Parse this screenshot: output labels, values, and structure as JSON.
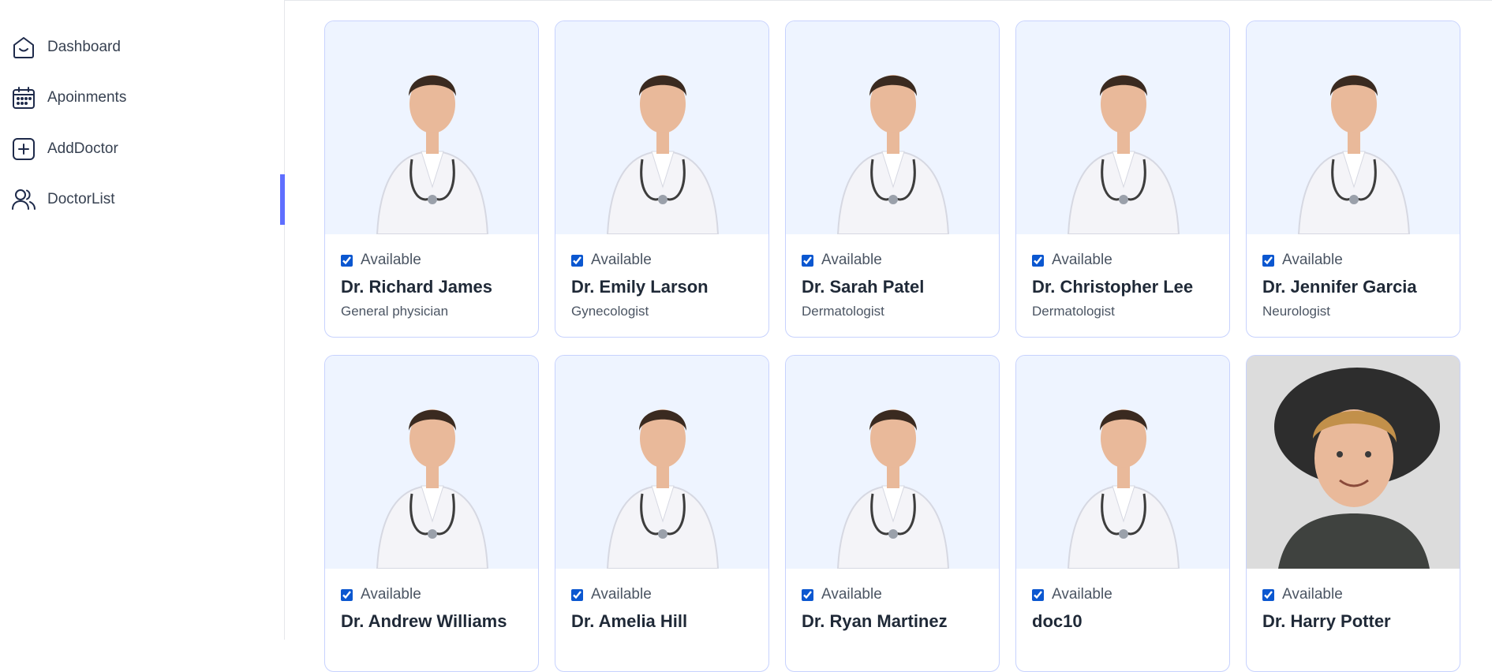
{
  "sidebar": {
    "items": [
      {
        "label": "Dashboard",
        "icon": "home-icon",
        "active": false
      },
      {
        "label": "Apoinments",
        "icon": "calendar-icon",
        "active": false
      },
      {
        "label": "AddDoctor",
        "icon": "add-icon",
        "active": false
      },
      {
        "label": "DoctorList",
        "icon": "people-icon",
        "active": true
      }
    ]
  },
  "colors": {
    "accent": "#5f6fff",
    "card_border": "#c7d2fe",
    "photo_bg": "#eef4ff"
  },
  "doctors": [
    {
      "available": true,
      "available_label": "Available",
      "name": "Dr. Richard James",
      "speciality": "General physician",
      "photo": "doctor-photo"
    },
    {
      "available": true,
      "available_label": "Available",
      "name": "Dr. Emily Larson",
      "speciality": "Gynecologist",
      "photo": "doctor-photo"
    },
    {
      "available": true,
      "available_label": "Available",
      "name": "Dr. Sarah Patel",
      "speciality": "Dermatologist",
      "photo": "doctor-photo"
    },
    {
      "available": true,
      "available_label": "Available",
      "name": "Dr. Christopher Lee",
      "speciality": "Dermatologist",
      "photo": "doctor-photo"
    },
    {
      "available": true,
      "available_label": "Available",
      "name": "Dr. Jennifer Garcia",
      "speciality": "Neurologist",
      "photo": "doctor-photo"
    },
    {
      "available": true,
      "available_label": "Available",
      "name": "Dr. Andrew Williams",
      "speciality": "",
      "photo": "doctor-photo"
    },
    {
      "available": true,
      "available_label": "Available",
      "name": "Dr. Amelia Hill",
      "speciality": "",
      "photo": "doctor-photo"
    },
    {
      "available": true,
      "available_label": "Available",
      "name": "Dr. Ryan Martinez",
      "speciality": "",
      "photo": "doctor-photo"
    },
    {
      "available": true,
      "available_label": "Available",
      "name": "doc10",
      "speciality": "",
      "photo": "doctor-photo"
    },
    {
      "available": true,
      "available_label": "Available",
      "name": "Dr. Harry Potter",
      "speciality": "",
      "photo": "person-photo"
    }
  ]
}
